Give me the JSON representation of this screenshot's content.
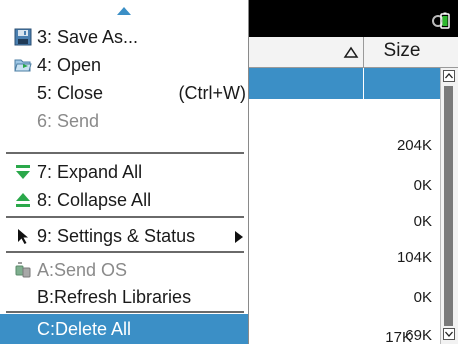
{
  "header": {
    "size_column": "Size"
  },
  "file_sizes": [
    "204K",
    "0K",
    "0K",
    "104K",
    "0K",
    "69K",
    "17K"
  ],
  "menu": {
    "items": [
      {
        "label": "3: Save As...",
        "icon": "save-disk-icon",
        "state": "enabled"
      },
      {
        "label": "4: Open",
        "icon": "open-folder-icon",
        "state": "enabled"
      },
      {
        "label": "5: Close",
        "shortcut": "(Ctrl+W)",
        "state": "enabled"
      },
      {
        "label": "6: Send",
        "state": "disabled"
      },
      {
        "label": "7: Expand All",
        "icon": "expand-all-icon",
        "state": "enabled"
      },
      {
        "label": "8: Collapse All",
        "icon": "collapse-all-icon",
        "state": "enabled"
      },
      {
        "label": "9: Settings & Status",
        "icon": "pointer-arrow-icon",
        "submenu": true,
        "state": "enabled"
      },
      {
        "label": "A:Send OS",
        "icon": "send-os-icon",
        "state": "disabled"
      },
      {
        "label": "B:Refresh Libraries",
        "state": "enabled"
      },
      {
        "label": "C:Delete All",
        "state": "highlighted"
      }
    ]
  },
  "colors": {
    "highlight": "#3b8fc6",
    "topbar": "#000000",
    "battery": "#2eb82e",
    "expand_icon": "#2aa84a",
    "disabled_text": "#8a8a8a"
  }
}
